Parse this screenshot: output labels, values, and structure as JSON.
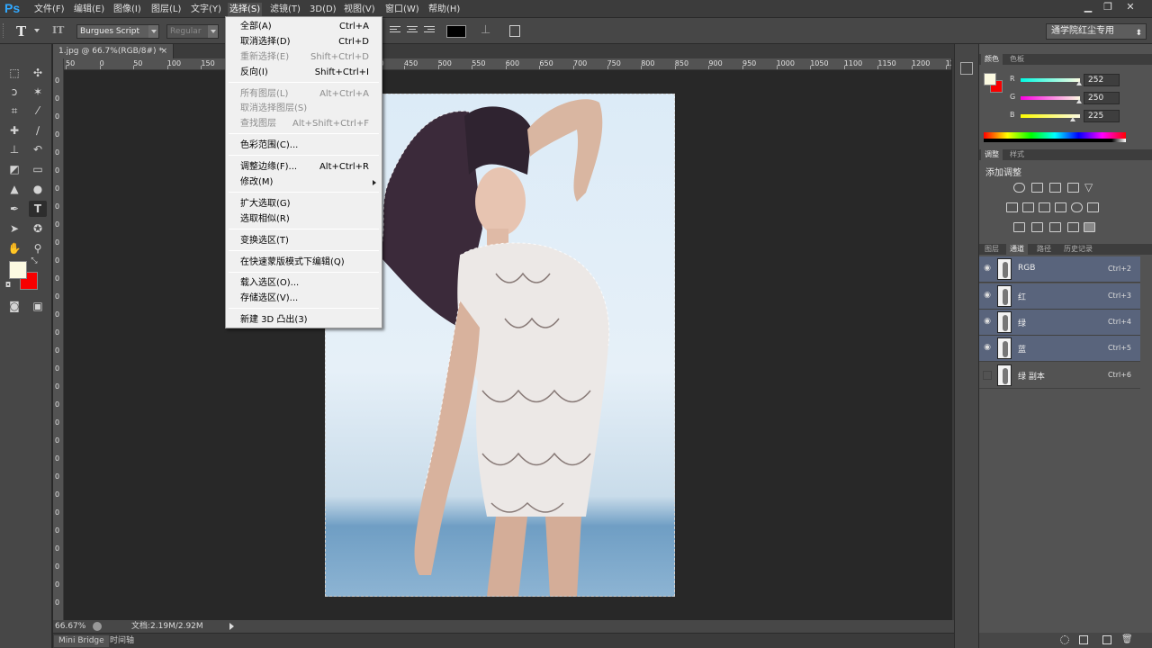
{
  "app": {
    "logo": "Ps",
    "menus": [
      "文件(F)",
      "编辑(E)",
      "图像(I)",
      "图层(L)",
      "文字(Y)",
      "选择(S)",
      "滤镜(T)",
      "3D(D)",
      "视图(V)",
      "窗口(W)",
      "帮助(H)"
    ],
    "active_menu": "选择(S)",
    "window_buttons": [
      "minimize",
      "restore",
      "close"
    ]
  },
  "options_bar": {
    "tool_glyph": "T",
    "font_family": "Burgues Script",
    "font_style": "Regular",
    "text_color": "#000000",
    "workspace": "通学院红尘专用"
  },
  "tools": {
    "foreground_color": "#fcfae1",
    "background_color": "#f80000"
  },
  "document": {
    "tab_title": "1.jpg @ 66.7%(RGB/8#) *",
    "tab_close": "×",
    "ruler_labels": [
      "50",
      "0",
      "50",
      "100",
      "150",
      "200",
      "250",
      "300",
      "350",
      "400",
      "450",
      "500",
      "550",
      "600",
      "650",
      "700",
      "750",
      "800",
      "850",
      "900",
      "950",
      "1000",
      "1050",
      "1100",
      "1150",
      "1200",
      "12"
    ]
  },
  "status": {
    "zoom": "66.67%",
    "doc_size": "文档:2.19M/2.92M"
  },
  "bottom_tabs": [
    "Mini Bridge",
    "时间轴"
  ],
  "select_menu": {
    "items": [
      {
        "label": "全部(A)",
        "shortcut": "Ctrl+A",
        "disabled": false
      },
      {
        "label": "取消选择(D)",
        "shortcut": "Ctrl+D",
        "disabled": false
      },
      {
        "label": "重新选择(E)",
        "shortcut": "Shift+Ctrl+D",
        "disabled": true
      },
      {
        "label": "反向(I)",
        "shortcut": "Shift+Ctrl+I",
        "disabled": false
      },
      {
        "label": "所有图层(L)",
        "shortcut": "Alt+Ctrl+A",
        "disabled": true
      },
      {
        "label": "取消选择图层(S)",
        "shortcut": "",
        "disabled": true
      },
      {
        "label": "查找图层",
        "shortcut": "Alt+Shift+Ctrl+F",
        "disabled": true
      },
      {
        "label": "色彩范围(C)...",
        "shortcut": "",
        "disabled": false
      },
      {
        "label": "调整边缘(F)...",
        "shortcut": "Alt+Ctrl+R",
        "disabled": false
      },
      {
        "label": "修改(M)",
        "shortcut": "",
        "disabled": false
      },
      {
        "label": "扩大选取(G)",
        "shortcut": "",
        "disabled": false
      },
      {
        "label": "选取相似(R)",
        "shortcut": "",
        "disabled": false
      },
      {
        "label": "变换选区(T)",
        "shortcut": "",
        "disabled": false
      },
      {
        "label": "在快速蒙版模式下编辑(Q)",
        "shortcut": "",
        "disabled": false
      },
      {
        "label": "载入选区(O)...",
        "shortcut": "",
        "disabled": false
      },
      {
        "label": "存储选区(V)...",
        "shortcut": "",
        "disabled": false
      },
      {
        "label": "新建 3D 凸出(3)",
        "shortcut": "",
        "disabled": false
      }
    ]
  },
  "color_panel": {
    "tabs": [
      "颜色",
      "色板"
    ],
    "sliders": [
      {
        "label": "R",
        "value": "252",
        "level": 0.988
      },
      {
        "label": "G",
        "value": "250",
        "level": 0.98
      },
      {
        "label": "B",
        "value": "225",
        "level": 0.882
      }
    ],
    "fg": "#fcfae1",
    "bg": "#f80000"
  },
  "adjust_panel": {
    "tabs": [
      "调整",
      "样式"
    ],
    "heading": "添加调整"
  },
  "channels_panel": {
    "tabs": [
      "图层",
      "通道",
      "路径",
      "历史记录"
    ],
    "channels": [
      {
        "name": "RGB",
        "shortcut": "Ctrl+2",
        "visible": true,
        "selected": true
      },
      {
        "name": "红",
        "shortcut": "Ctrl+3",
        "visible": true,
        "selected": true
      },
      {
        "name": "绿",
        "shortcut": "Ctrl+4",
        "visible": true,
        "selected": true
      },
      {
        "name": "蓝",
        "shortcut": "Ctrl+5",
        "visible": true,
        "selected": true
      },
      {
        "name": "绿 副本",
        "shortcut": "Ctrl+6",
        "visible": false,
        "selected": false
      }
    ]
  }
}
